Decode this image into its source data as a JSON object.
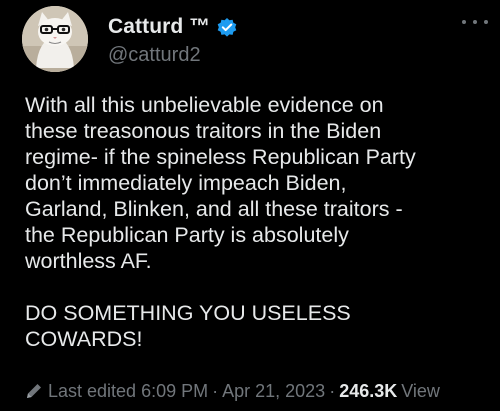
{
  "tweet": {
    "display_name": "Catturd ™",
    "handle": "@catturd2",
    "lines": [
      "With all this unbelievable evidence on",
      "these treasonous traitors in the Biden",
      "regime- if the spineless Republican Party",
      "don’t immediately impeach Biden,",
      "Garland, Blinken, and all these traitors -",
      "the Republican Party is absolutely",
      "worthless AF."
    ],
    "closing_lines": [
      "DO SOMETHING YOU USELESS",
      "COWARDS!"
    ],
    "edited_label": "Last edited 6:09 PM",
    "separator": "·",
    "date": "Apr 21, 2023",
    "views_count": "246.3K",
    "views_label": "View"
  },
  "colors": {
    "background": "#000000",
    "text": "#e7e9ea",
    "secondary": "#71767b",
    "verified": "#1d9bf0"
  },
  "icons": {
    "verified": "verified-badge-icon",
    "more": "more-dots-icon",
    "edited": "pencil-icon"
  }
}
